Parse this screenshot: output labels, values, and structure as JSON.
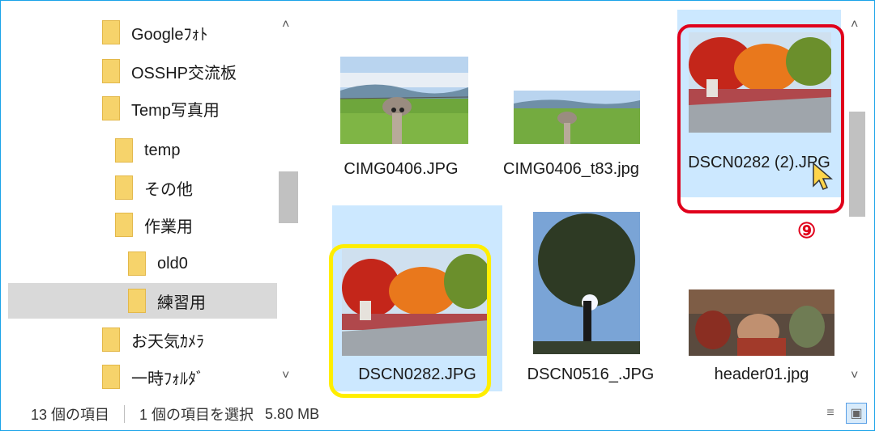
{
  "sidebar": {
    "items": [
      {
        "label": "Googleﾌｫﾄ"
      },
      {
        "label": "OSSHP交流板"
      },
      {
        "label": "Temp写真用"
      },
      {
        "label": "temp"
      },
      {
        "label": "その他"
      },
      {
        "label": "作業用"
      },
      {
        "label": "old0"
      },
      {
        "label": "練習用"
      },
      {
        "label": "お天気ｶﾒﾗ"
      },
      {
        "label": "一時ﾌｫﾙﾀﾞ"
      }
    ]
  },
  "files": [
    {
      "name": "CIMG0406.JPG"
    },
    {
      "name": "CIMG0406_t83.jpg"
    },
    {
      "name": "DSCN0282 (2).JPG"
    },
    {
      "name": "DSCN0282.JPG"
    },
    {
      "name": "DSCN0516_.JPG"
    },
    {
      "name": "header01.jpg"
    }
  ],
  "annotation": {
    "marker": "⑨"
  },
  "statusbar": {
    "item_count": "13 個の項目",
    "selection": "1 個の項目を選択",
    "size": "5.80 MB"
  },
  "icons": {
    "scroll_up": "chevron-up-icon",
    "scroll_down": "chevron-down-icon",
    "details_view": "details-view-icon",
    "large_icons_view": "large-icons-view-icon"
  },
  "colors": {
    "selection_bg": "#cce8ff",
    "tree_selected_bg": "#d9d9d9",
    "highlight_red": "#e0001b",
    "highlight_yellow": "#ffee00",
    "folder": "#f6d36b"
  }
}
